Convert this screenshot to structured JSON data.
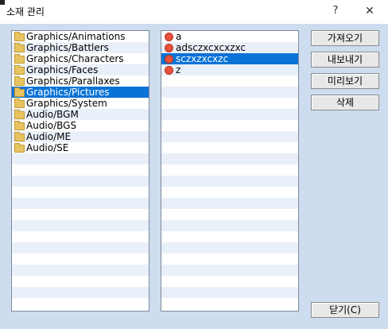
{
  "window": {
    "title": "소재 관리",
    "help_label": "?",
    "close_label": "✕"
  },
  "folders": {
    "items": [
      "Graphics/Animations",
      "Graphics/Battlers",
      "Graphics/Characters",
      "Graphics/Faces",
      "Graphics/Parallaxes",
      "Graphics/Pictures",
      "Graphics/System",
      "Audio/BGM",
      "Audio/BGS",
      "Audio/ME",
      "Audio/SE"
    ],
    "selected_index": 5
  },
  "files": {
    "items": [
      "a",
      "adsczxcxcxzxc",
      "sczxzxcxzc",
      "z"
    ],
    "selected_index": 2
  },
  "buttons": {
    "import": "가져오기",
    "export": "내보내기",
    "preview": "미리보기",
    "delete": "삭제",
    "close": "닫기(C)"
  },
  "colors": {
    "selection": "#0a73d6",
    "dialog_bg": "#cddcef"
  }
}
